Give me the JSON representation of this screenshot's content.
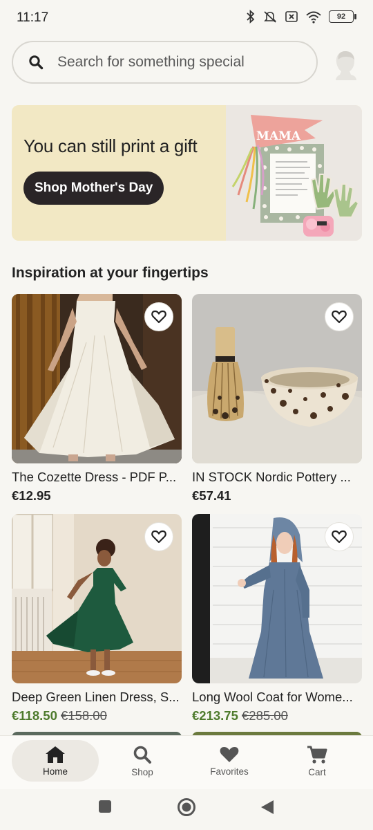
{
  "status_bar": {
    "time": "11:17",
    "battery": "92"
  },
  "search": {
    "placeholder": "Search for something special"
  },
  "banner": {
    "title": "You can still print a gift",
    "button_label": "Shop Mother's Day",
    "pennant_text": "MAMA"
  },
  "section": {
    "title": "Inspiration at your fingertips"
  },
  "products": [
    {
      "title": "The Cozette Dress - PDF P...",
      "price": "€12.95",
      "original_price": ""
    },
    {
      "title": "IN STOCK Nordic Pottery ...",
      "price": "€57.41",
      "original_price": ""
    },
    {
      "title": "Deep Green Linen Dress, S...",
      "price": "€118.50",
      "original_price": "€158.00"
    },
    {
      "title": "Long Wool Coat for Wome...",
      "price": "€213.75",
      "original_price": "€285.00"
    }
  ],
  "bottom_nav": [
    {
      "label": "Home",
      "icon": "home-icon",
      "active": true
    },
    {
      "label": "Shop",
      "icon": "search-icon",
      "active": false
    },
    {
      "label": "Favorites",
      "icon": "heart-icon",
      "active": false
    },
    {
      "label": "Cart",
      "icon": "cart-icon",
      "active": false
    }
  ],
  "colors": {
    "sale_price": "#4d7a2c",
    "banner_bg": "#f2e8c4",
    "button_bg": "#2a2527",
    "page_bg": "#f7f6f2"
  }
}
